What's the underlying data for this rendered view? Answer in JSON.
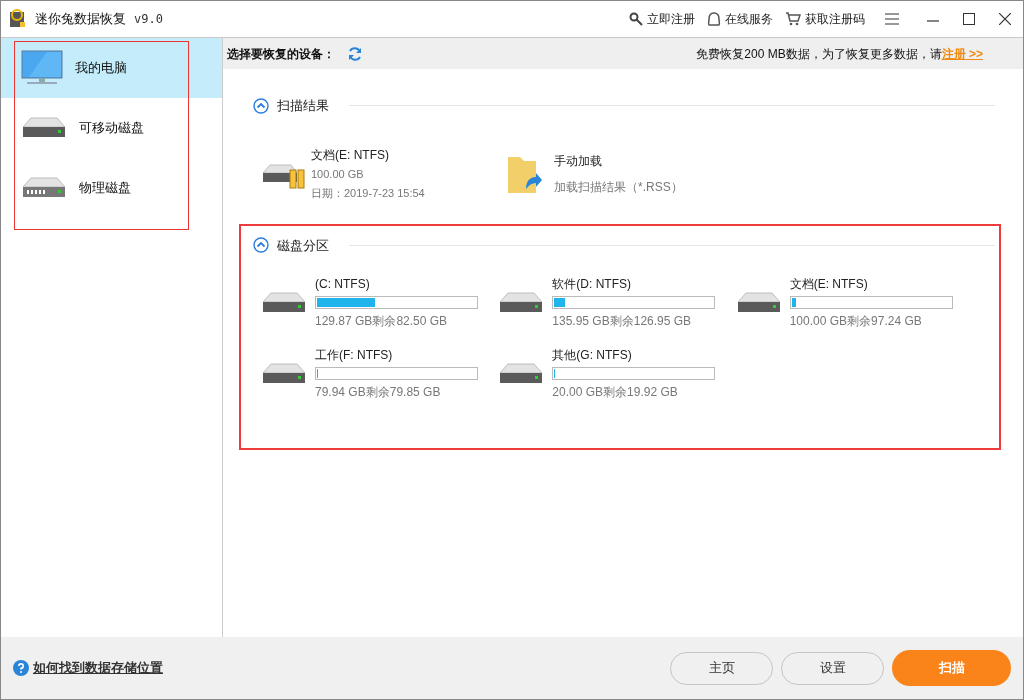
{
  "window": {
    "title": "迷你兔数据恢复",
    "version": "v9.0"
  },
  "title_actions": [
    {
      "kind": "register",
      "label": "立即注册"
    },
    {
      "kind": "service",
      "label": "在线服务"
    },
    {
      "kind": "cart",
      "label": "获取注册码"
    }
  ],
  "sidebar": {
    "items": [
      {
        "kind": "computer",
        "label": "我的电脑",
        "selected": true
      },
      {
        "kind": "removable",
        "label": "可移动磁盘",
        "selected": false
      },
      {
        "kind": "physical",
        "label": "物理磁盘",
        "selected": false
      }
    ]
  },
  "toolbar": {
    "label": "选择要恢复的设备：",
    "notice": "免费恢复200 MB数据，为了恢复更多数据，请",
    "register_link": "注册 >>"
  },
  "scan_results": {
    "title": "扫描结果",
    "expanded": true,
    "items": [
      {
        "kind": "drive",
        "name": "文档(E: NTFS)",
        "size": "100.00 GB",
        "date": "日期：2019-7-23 15:54"
      },
      {
        "kind": "load",
        "name": "手动加载",
        "detail": "加载扫描结果（*.RSS）"
      }
    ]
  },
  "partitions": {
    "title": "磁盘分区",
    "expanded": true,
    "items": [
      {
        "name": "(C: NTFS)",
        "level": 0.365,
        "info": "129.87 GB剩余82.50 GB"
      },
      {
        "name": "软件(D: NTFS)",
        "level": 0.066,
        "info": "135.95 GB剩余126.95 GB"
      },
      {
        "name": "文档(E: NTFS)",
        "level": 0.028,
        "info": "100.00 GB剩余97.24 GB"
      },
      {
        "name": "工作(F: NTFS)",
        "level": 0.001,
        "info": "79.94 GB剩余79.85 GB"
      },
      {
        "name": "其他(G: NTFS)",
        "level": 0.004,
        "info": "20.00 GB剩余19.92 GB"
      }
    ]
  },
  "footer": {
    "help_link": "如何找到数据存储位置",
    "buttons": [
      {
        "kind": "plain",
        "label": "主页"
      },
      {
        "kind": "plain",
        "label": "设置"
      },
      {
        "kind": "primary",
        "label": "扫描"
      }
    ]
  }
}
